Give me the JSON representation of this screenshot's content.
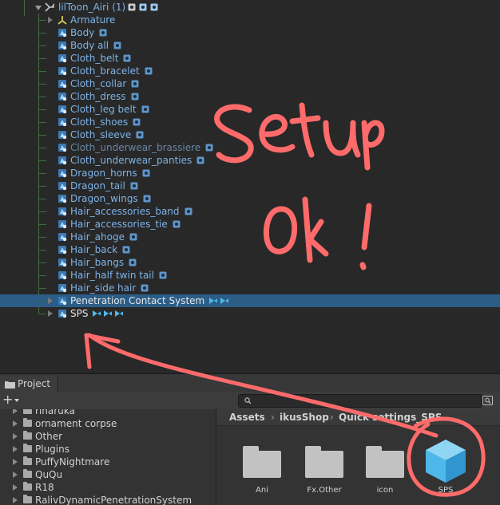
{
  "hierarchy": {
    "root": {
      "label": "lilToon_Airi (1)"
    },
    "children": [
      {
        "label": "Armature"
      },
      {
        "label": "Body"
      },
      {
        "label": "Body all"
      },
      {
        "label": "Cloth_belt"
      },
      {
        "label": "Cloth_bracelet"
      },
      {
        "label": "Cloth_collar"
      },
      {
        "label": "Cloth_dress"
      },
      {
        "label": "Cloth_leg belt"
      },
      {
        "label": "Cloth_shoes"
      },
      {
        "label": "Cloth_sleeve"
      },
      {
        "label": "Cloth_underwear_brassiere"
      },
      {
        "label": "Cloth_underwear_panties"
      },
      {
        "label": "Dragon_horns"
      },
      {
        "label": "Dragon_tail"
      },
      {
        "label": "Dragon_wings"
      },
      {
        "label": "Hair_accessories_band"
      },
      {
        "label": "Hair_accessories_tie"
      },
      {
        "label": "Hair_ahoge"
      },
      {
        "label": "Hair_back"
      },
      {
        "label": "Hair_bangs"
      },
      {
        "label": "Hair_half twin tail"
      },
      {
        "label": "Hair_side hair"
      },
      {
        "label": "Penetration Contact System"
      },
      {
        "label": "SPS"
      }
    ]
  },
  "annotation": {
    "line1": "Setup",
    "line2": "ok !"
  },
  "project": {
    "tab_label": "Project",
    "add_label": "+",
    "tree_items": [
      "riharuka",
      "ornament corpse",
      "Other",
      "Plugins",
      "PuffyNightmare",
      "QuQu",
      "R18",
      "RalivDynamicPenetrationSystem"
    ],
    "breadcrumb": [
      "Assets",
      "ikusShop",
      "Quick settings_SPS"
    ],
    "tiles": [
      {
        "name": "Ani",
        "kind": "folder"
      },
      {
        "name": "Fx.Other",
        "kind": "folder"
      },
      {
        "name": "icon",
        "kind": "folder"
      },
      {
        "name": "SPS",
        "kind": "prefab"
      }
    ]
  },
  "colors": {
    "object_label": "#7db3e8",
    "selection": "#2c5d87",
    "annotation_ink": "#ff6b6b",
    "sps_prefab": "#4fb8ea"
  }
}
